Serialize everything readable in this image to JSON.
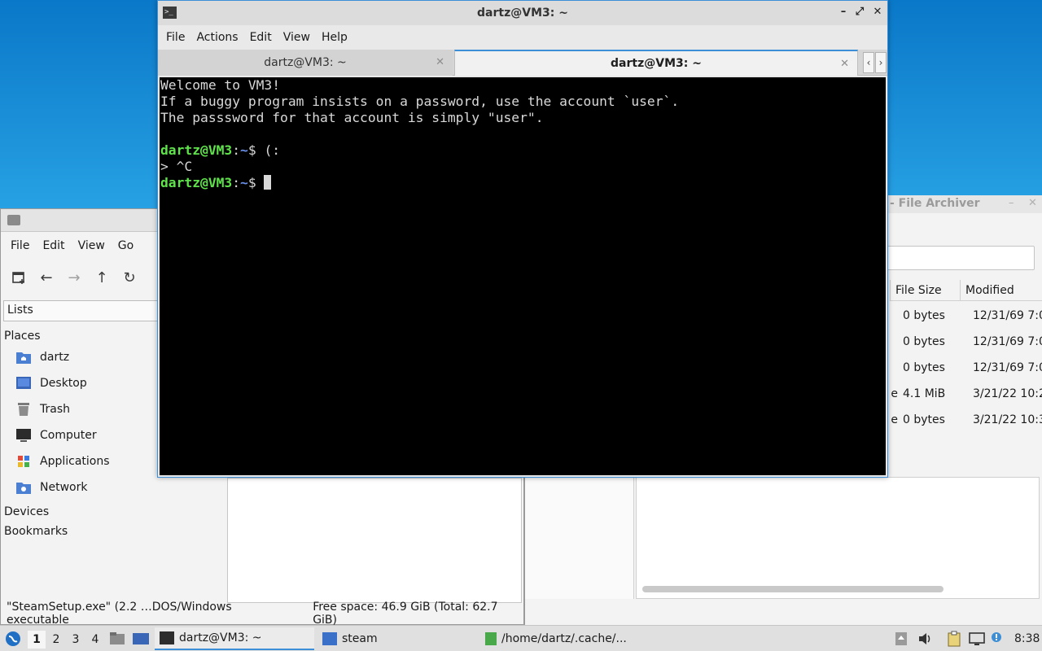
{
  "terminal": {
    "title": "dartz@VM3: ~",
    "menu": [
      "File",
      "Actions",
      "Edit",
      "View",
      "Help"
    ],
    "tabs": [
      {
        "label": "dartz@VM3: ~",
        "active": false
      },
      {
        "label": "dartz@VM3: ~",
        "active": true
      }
    ],
    "lines": {
      "l1": "Welcome to VM3!",
      "l2": "If a buggy program insists on a password, use the account `user`.",
      "l3": "The passsword for that account is simply \"user\".",
      "prompt_user": "dartz@VM3",
      "prompt_sep": ":",
      "prompt_path": "~",
      "prompt_end": "$ ",
      "cmd1": "(:",
      "l6": "> ^C"
    }
  },
  "file_manager": {
    "menu": [
      "File",
      "Edit",
      "View",
      "Go"
    ],
    "side_select": "Lists",
    "sections": {
      "places": "Places",
      "devices": "Devices",
      "bookmarks": "Bookmarks"
    },
    "places": [
      {
        "label": "dartz",
        "icon": "home-folder-icon"
      },
      {
        "label": "Desktop",
        "icon": "desktop-icon"
      },
      {
        "label": "Trash",
        "icon": "trash-icon"
      },
      {
        "label": "Computer",
        "icon": "computer-icon"
      },
      {
        "label": "Applications",
        "icon": "applications-icon"
      },
      {
        "label": "Network",
        "icon": "network-icon"
      }
    ],
    "status_selected": "\"SteamSetup.exe\" (2.2 …DOS/Windows executable",
    "status_free": "Free space: 46.9 GiB (Total: 62.7 GiB)"
  },
  "archiver": {
    "title": "- File Archiver",
    "columns": {
      "size": "File Size",
      "modified": "Modified"
    },
    "rows": [
      {
        "name": "",
        "size": "0 bytes",
        "modified": "12/31/69 7:0"
      },
      {
        "name": "",
        "size": "0 bytes",
        "modified": "12/31/69 7:0"
      },
      {
        "name": "",
        "size": "0 bytes",
        "modified": "12/31/69 7:0"
      },
      {
        "name": "e",
        "size": "4.1 MiB",
        "modified": "3/21/22 10:2"
      },
      {
        "name": "e",
        "size": "0 bytes",
        "modified": "3/21/22 10:3"
      }
    ]
  },
  "taskbar": {
    "workspaces": [
      "1",
      "2",
      "3",
      "4"
    ],
    "active_workspace": "1",
    "tasks": [
      {
        "label": "dartz@VM3: ~",
        "icon": "terminal-icon"
      },
      {
        "label": "steam",
        "icon": "folder-icon"
      },
      {
        "label": "/home/dartz/.cache/...",
        "icon": "archive-icon"
      }
    ],
    "clock": "8:38"
  },
  "colors": {
    "accent": "#3c8ed6",
    "prompt_user": "#5fe34b",
    "prompt_path": "#6a8fe8"
  }
}
